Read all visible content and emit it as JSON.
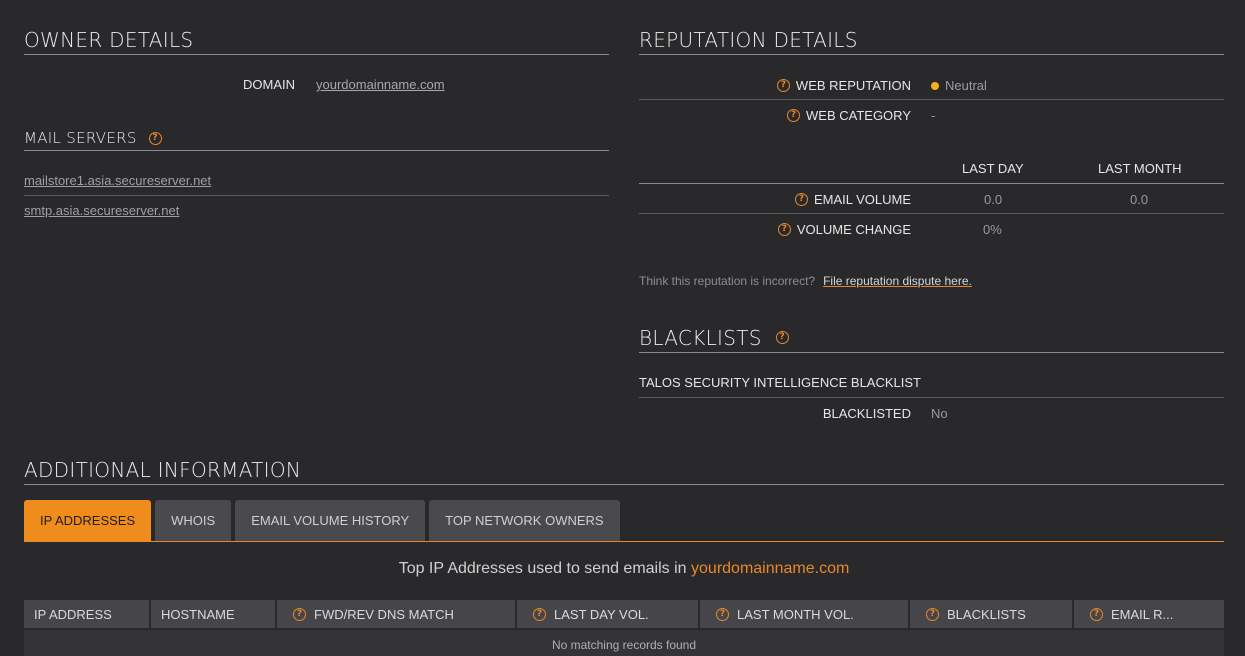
{
  "owner": {
    "title": "OWNER DETAILS",
    "domain_label": "DOMAIN",
    "domain_value": "yourdomainname.com"
  },
  "mail_servers": {
    "title": "MAIL SERVERS",
    "items": [
      "mailstore1.asia.secureserver.net",
      "smtp.asia.secureserver.net"
    ]
  },
  "reputation": {
    "title": "REPUTATION DETAILS",
    "web_reputation_label": "WEB REPUTATION",
    "web_reputation_value": "Neutral",
    "web_reputation_color": "#f0b419",
    "web_category_label": "WEB CATEGORY",
    "web_category_value": "-",
    "col_last_day": "LAST DAY",
    "col_last_month": "LAST MONTH",
    "email_volume_label": "EMAIL VOLUME",
    "email_volume_day": "0.0",
    "email_volume_month": "0.0",
    "volume_change_label": "VOLUME CHANGE",
    "volume_change_day": "0%",
    "dispute_text": "Think this reputation is incorrect?",
    "dispute_link": "File reputation dispute here."
  },
  "blacklists": {
    "title": "BLACKLISTS",
    "subheading": "TALOS SECURITY INTELLIGENCE BLACKLIST",
    "blacklisted_label": "BLACKLISTED",
    "blacklisted_value": "No"
  },
  "additional": {
    "title": "ADDITIONAL INFORMATION",
    "tabs": [
      "IP ADDRESSES",
      "WHOIS",
      "EMAIL VOLUME HISTORY",
      "TOP NETWORK OWNERS"
    ],
    "active_tab": "IP ADDRESSES",
    "caption_prefix": "Top IP Addresses used to send emails in",
    "caption_domain": "yourdomainname.com",
    "columns": [
      "IP ADDRESS",
      "HOSTNAME",
      "FWD/REV DNS MATCH",
      "LAST DAY VOL.",
      "LAST MONTH VOL.",
      "BLACKLISTS",
      "EMAIL R..."
    ],
    "empty_message": "No matching records found"
  },
  "colors": {
    "accent": "#e8872b",
    "background": "#29292c"
  },
  "icons": {
    "help": "question-circle-icon",
    "status": "status-dot-icon"
  }
}
